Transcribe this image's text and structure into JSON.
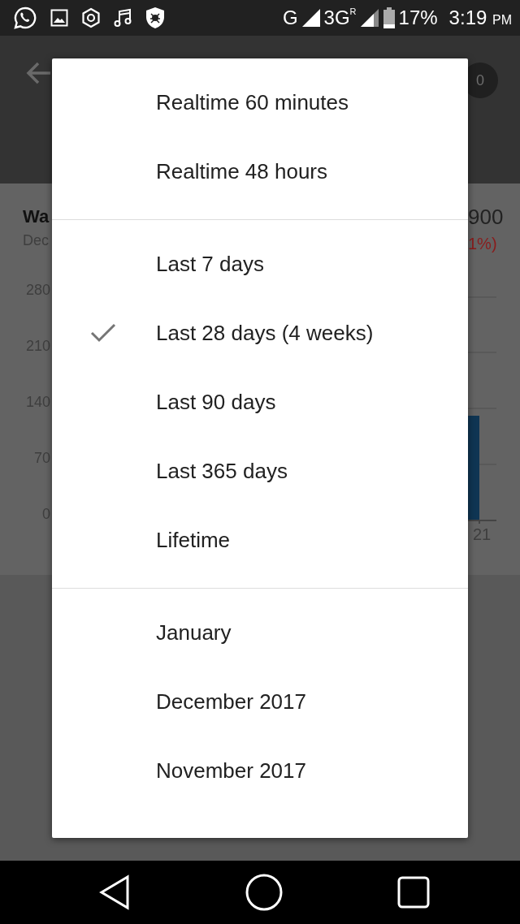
{
  "status_bar": {
    "network": "G",
    "network_2": "3G",
    "roaming": "R",
    "battery": "17%",
    "time": "3:19",
    "time_suffix": "PM"
  },
  "header": {
    "badge": "0"
  },
  "background": {
    "title": "Wa",
    "subtitle": "Dec",
    "value": "900",
    "change": "1%)",
    "yticks": [
      "280",
      "210",
      "140",
      "70",
      "0"
    ],
    "xlabel": "21"
  },
  "menu": {
    "groups": [
      [
        {
          "label": "Realtime 60 minutes",
          "selected": false
        },
        {
          "label": "Realtime 48 hours",
          "selected": false
        }
      ],
      [
        {
          "label": "Last 7 days",
          "selected": false
        },
        {
          "label": "Last 28 days (4 weeks)",
          "selected": true
        },
        {
          "label": "Last 90 days",
          "selected": false
        },
        {
          "label": "Last 365 days",
          "selected": false
        },
        {
          "label": "Lifetime",
          "selected": false
        }
      ],
      [
        {
          "label": "January",
          "selected": false
        },
        {
          "label": "December 2017",
          "selected": false
        },
        {
          "label": "November 2017",
          "selected": false
        }
      ]
    ]
  }
}
